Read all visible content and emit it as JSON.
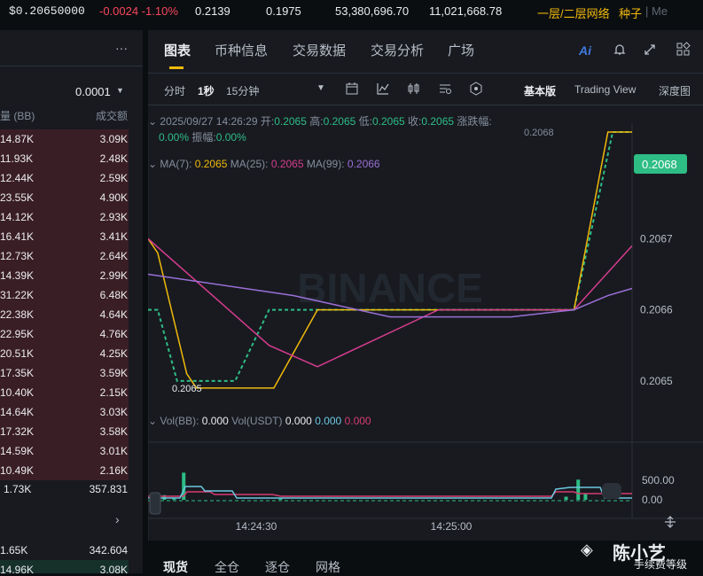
{
  "ticker": {
    "price": "$0.20650000",
    "change": "-0.0024 -1.10%",
    "high": "0.2139",
    "low": "0.1975",
    "volume_base": "53,380,696.70",
    "volume_quote": "11,021,668.78",
    "tag": "一层/二层网络",
    "tag2": "种子",
    "tag3": "| Me"
  },
  "orderbook": {
    "more_label": "···",
    "precision": "0.0001",
    "col_qty": "量 (BB)",
    "col_total": "成交额",
    "asks": [
      {
        "qty": "14.87K",
        "total": "3.09K"
      },
      {
        "qty": "11.93K",
        "total": "2.48K"
      },
      {
        "qty": "12.44K",
        "total": "2.59K"
      },
      {
        "qty": "23.55K",
        "total": "4.90K"
      },
      {
        "qty": "14.12K",
        "total": "2.93K"
      },
      {
        "qty": "16.41K",
        "total": "3.41K"
      },
      {
        "qty": "12.73K",
        "total": "2.64K"
      },
      {
        "qty": "14.39K",
        "total": "2.99K"
      },
      {
        "qty": "31.22K",
        "total": "6.48K"
      },
      {
        "qty": "22.38K",
        "total": "4.64K"
      },
      {
        "qty": "22.95K",
        "total": "4.76K"
      },
      {
        "qty": "20.51K",
        "total": "4.25K"
      },
      {
        "qty": "17.35K",
        "total": "3.59K"
      },
      {
        "qty": "10.40K",
        "total": "2.15K"
      },
      {
        "qty": "14.64K",
        "total": "3.03K"
      },
      {
        "qty": "17.32K",
        "total": "3.58K"
      },
      {
        "qty": "14.59K",
        "total": "3.01K"
      },
      {
        "qty": "10.49K",
        "total": "2.16K"
      }
    ],
    "mid": {
      "qty": "1.73K",
      "total": "357.831"
    },
    "bids": [
      {
        "qty": "1.65K",
        "total": "342.604"
      },
      {
        "qty": "14.96K",
        "total": "3.08K"
      }
    ]
  },
  "chart_tabs": [
    "图表",
    "币种信息",
    "交易数据",
    "交易分析",
    "广场"
  ],
  "toolbar": {
    "time_label": "分时",
    "interval_1": "1秒",
    "interval_2": "15分钟",
    "view_basic": "基本版",
    "view_tv": "Trading View",
    "view_depth": "深度图",
    "ai_label": "Ai"
  },
  "ohlc": {
    "datetime": "2025/09/27 14:26:29",
    "open_label": "开:",
    "open": "0.2065",
    "high_label": "高:",
    "high": "0.2065",
    "low_label": "低:",
    "low": "0.2065",
    "close_label": "收:",
    "close": "0.2065",
    "change_label": "涨跌幅:",
    "change": "0.00%",
    "amp_label": "振幅:",
    "amp": "0.00%"
  },
  "ma": {
    "ma7_label": "MA(7):",
    "ma7": "0.2065",
    "ma25_label": "MA(25):",
    "ma25": "0.2065",
    "ma99_label": "MA(99):",
    "ma99": "0.2066"
  },
  "vol": {
    "base_label": "Vol(BB):",
    "base": "0.000",
    "quote_label": "Vol(USDT)",
    "quote": "0.000",
    "v2": "0.000",
    "v3": "0.000"
  },
  "watermark": "BINANCE",
  "colors": {
    "up": "#2ebd85",
    "down": "#f6465d",
    "ma7": "#f0b90b",
    "ma25": "#d63c8e",
    "ma99": "#9b6fd6",
    "accent": "#f0b90b"
  },
  "chart_data": [
    {
      "type": "line",
      "x": [
        "14:24:30",
        "14:25:00"
      ],
      "yticks": [
        "0.2067",
        "0.2066",
        "0.2065"
      ],
      "ylim": [
        0.20642,
        0.20685
      ],
      "price_points": [
        [
          0,
          0.2066
        ],
        [
          0.02,
          0.2066
        ],
        [
          0.06,
          0.2065
        ],
        [
          0.11,
          0.2065
        ],
        [
          0.18,
          0.2065
        ],
        [
          0.25,
          0.2066
        ],
        [
          0.75,
          0.2066
        ],
        [
          0.88,
          0.2066
        ],
        [
          0.96,
          0.20685
        ],
        [
          1,
          0.20685
        ]
      ],
      "current_price": "0.2068",
      "current_price_overlay": "0.2068",
      "low_marker": "0.2065",
      "series": [
        {
          "name": "MA(7)",
          "values": [
            [
              0,
              0.2067
            ],
            [
              0.02,
              0.20668
            ],
            [
              0.08,
              0.20651
            ],
            [
              0.1,
              0.20649
            ],
            [
              0.26,
              0.20649
            ],
            [
              0.35,
              0.2066
            ],
            [
              0.88,
              0.2066
            ],
            [
              0.95,
              0.20685
            ],
            [
              1,
              0.20685
            ]
          ]
        },
        {
          "name": "MA(25)",
          "values": [
            [
              0,
              0.2067
            ],
            [
              0.25,
              0.20655
            ],
            [
              0.35,
              0.20652
            ],
            [
              0.6,
              0.2066
            ],
            [
              0.88,
              0.2066
            ],
            [
              1,
              0.20669
            ]
          ]
        },
        {
          "name": "MA(99)",
          "values": [
            [
              0,
              0.20665
            ],
            [
              0.3,
              0.20662
            ],
            [
              0.5,
              0.20659
            ],
            [
              0.75,
              0.20659
            ],
            [
              0.88,
              0.2066
            ],
            [
              0.95,
              0.20662
            ],
            [
              1,
              0.20663
            ]
          ]
        }
      ]
    },
    {
      "type": "bar",
      "yticks": [
        "500.00",
        "0.00"
      ],
      "ylim": [
        0,
        800
      ],
      "bars": [
        [
          0.005,
          60
        ],
        [
          0.03,
          120
        ],
        [
          0.05,
          30
        ],
        [
          0.07,
          700
        ],
        [
          0.27,
          30
        ],
        [
          0.86,
          80
        ],
        [
          0.885,
          520
        ],
        [
          0.9,
          150
        ]
      ]
    }
  ]
}
